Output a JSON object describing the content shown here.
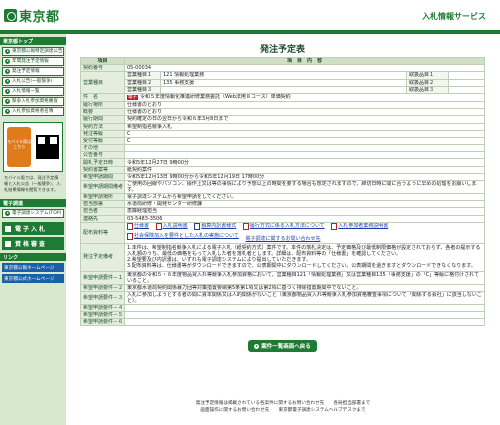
{
  "header": {
    "logo_text": "東京都",
    "service_title": "入札情報サービス"
  },
  "sidebar": {
    "section1_title": "東京都トップ",
    "menu_items": [
      "東京都公報特定調達公告",
      "年間発注予定情報",
      "発注予定情報",
      "入札公告(一般競争)",
      "入札情報一覧",
      "競争入札参加資格審査",
      "入札参加資格者名簿"
    ],
    "mobile_badge": "モバイル版はこちら",
    "mobile_note": "モバイル版では、発注予定情報と入札公告（一般競争）、入札結果情報を閲覧できます。",
    "section2_title": "電子調達",
    "system_link": "電子調達システム(TOP)",
    "big_buttons": [
      "電子入札",
      "資格審査"
    ],
    "section3_title": "リンク",
    "link_tiles": [
      "東京都公報ホームページ",
      "東京都公式ホームページ"
    ]
  },
  "main": {
    "page_title": "発注予定表",
    "col_item": "項目",
    "col_content": "項　目　内　容",
    "rows": {
      "contract_no_label": "契約番号",
      "contract_no": "05-00034",
      "business_type_label": "営業種目",
      "business_types": [
        {
          "label": "営業種目１",
          "value": "121 情報処理業務",
          "cat_label": "取扱品目１",
          "cat": ""
        },
        {
          "label": "営業種目２",
          "value": "135 事務支援",
          "cat_label": "取扱品目２",
          "cat": ""
        },
        {
          "label": "営業種目３",
          "value": "",
          "cat_label": "取扱品目３",
          "cat": ""
        }
      ],
      "subject_label": "件　名",
      "subject_tag": "電子",
      "subject": "令和５年度情報化推進研修業務委託（Web法用８コース）単価契約",
      "location_label": "履行場所",
      "location": "仕様書のとおり",
      "summary_label": "概要",
      "summary": "仕様書のとおり",
      "period_label": "履行期間",
      "period": "契約確定の日の翌日から令和６年3月8日まで",
      "method_label": "契約方法",
      "method": "希望制指名競争入札",
      "publish_label": "発注等級",
      "publish": "C",
      "receive_label": "受付等級",
      "receive": "C",
      "other_label": "その他",
      "other": "",
      "notice_label": "公告番号",
      "notice": "",
      "bid_date_label": "開札予定日時",
      "bid_date": "令和5年12月27日 9時00分",
      "contract_type_label": "契約書案等",
      "contract_type": "紙契約案件",
      "apply_period_label": "希望申請期間",
      "apply_period": "令和5年12月13日 9時00分から令和5年12月19日 17時00分",
      "apply_note_label": "希望申請期間備考",
      "apply_note": "ご使用の回線やパソコン、操作上又は等の事情により予想以上の時間を要する場合も想定されますので、締切日時に間に合うように早めの処理をお願いします。",
      "apply_place_label": "希望申請場所",
      "apply_place": "電子調達システムから希望申請をしてください。",
      "dept_label": "担当部署",
      "dept": "水道局研修・開発センター研修課",
      "person_label": "担当者",
      "person": "恵藤経理担当",
      "phone_label": "連絡先",
      "phone": "03-5483-3506",
      "docs_label": "配布資料等",
      "docs": [
        "仕様書",
        "入札説明書",
        "積算内訳書様式",
        "履行方式に係る入札方法について",
        "入札参加者業務説明書",
        "社会保険加入を要件とした入札の実施について"
      ],
      "docs_link": "電子調達に関するお問い合わせ先",
      "notes_label": "発注予定備考",
      "notes": [
        "1.本件は、希望制指名競争入札による電子入札（紙契約方式）案件です。本件の落札決定は、予定価格及び最低制限価格が設定されておらず、各者の提示する入札額のうち、最低の価格をもって入札した者を落札者とします。詳細は、配布資料等の「仕様書」を確認してください。",
        "2.希望要及び内訳書は、いずれも電子調達システムにより提出していただきます。",
        "3.配布資料等は、仕様書等がダウンロードできますので、公表期間中にダウンロードしてください。公表期間を過ぎますとダウンロードできなくなります。"
      ],
      "req1_label": "希望申請要件－１",
      "req1": "東京都の令和５・６年度物品買入れ等競争入札参加資格において、営業種目121「情報処理業務」又は営業種目135「事務支援」の「C」等級に格付けされていること。",
      "req2_label": "希望申請要件－２",
      "req2": "東京都水道局契約関係暴力団等対策措置要綱第5条第1項又は第2項に基づく排除措置期間中でないこと。",
      "req3_label": "希望申請要件－３",
      "req3": "入札に参加しようとする者の間に資本関係又は人的関係がないこと（東京都物品買入れ等競争入札参加資格審査事項について「関係する会社」に該当しないこと）。",
      "req4_label": "希望申請要件－４",
      "req4": "",
      "req5_label": "希望申請要件－５",
      "req5": "",
      "req6_label": "希望申請要件－６",
      "req6": ""
    },
    "back_button": "案件一覧画面へ戻る"
  },
  "footer": {
    "line1": "発注予定情報は掲載されている各案件に関するお問い合わせ先　　各局担当部署まで",
    "line2": "画面操作に関するお問い合わせ先　　東京都電子調達システムヘルプデスクまで"
  },
  "colors": {
    "brand_green": "#1e7b34",
    "label_bg": "#e3eedc",
    "link_blue": "#1a3fa8"
  }
}
